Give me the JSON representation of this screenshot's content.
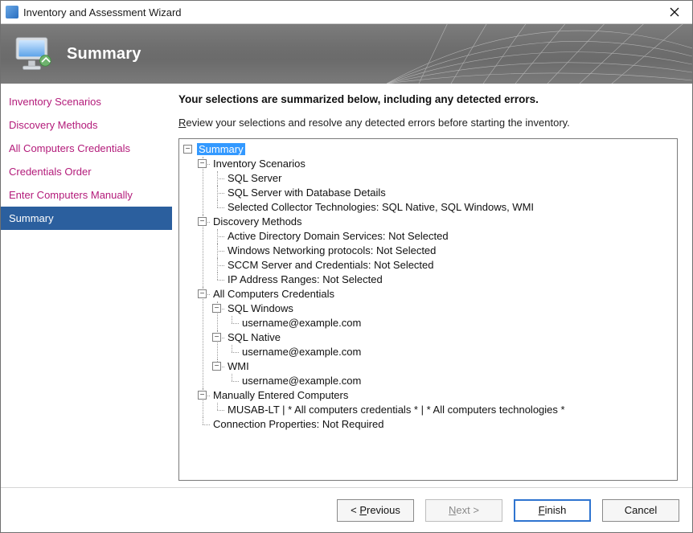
{
  "window": {
    "title": "Inventory and Assessment Wizard"
  },
  "banner": {
    "title": "Summary"
  },
  "sidebar": {
    "items": [
      {
        "label": "Inventory Scenarios",
        "state": "visited"
      },
      {
        "label": "Discovery Methods",
        "state": "visited"
      },
      {
        "label": "All Computers Credentials",
        "state": "visited"
      },
      {
        "label": "Credentials Order",
        "state": "visited"
      },
      {
        "label": "Enter Computers Manually",
        "state": "visited"
      },
      {
        "label": "Summary",
        "state": "active"
      }
    ]
  },
  "content": {
    "heading": "Your selections are summarized below, including any detected errors.",
    "subheading_prefix": "R",
    "subheading_rest": "eview your selections and resolve any detected errors before starting the inventory."
  },
  "tree": {
    "root": "Summary",
    "inventory_scenarios": {
      "label": "Inventory Scenarios",
      "items": [
        "SQL Server",
        "SQL Server with Database Details",
        "Selected Collector Technologies: SQL Native, SQL Windows, WMI"
      ]
    },
    "discovery_methods": {
      "label": "Discovery Methods",
      "items": [
        "Active Directory Domain Services: Not Selected",
        "Windows Networking protocols: Not Selected",
        "SCCM Server and Credentials: Not Selected",
        "IP Address Ranges: Not Selected"
      ]
    },
    "credentials": {
      "label": "All Computers Credentials",
      "groups": [
        {
          "name": "SQL Windows",
          "user": "username@example.com"
        },
        {
          "name": "SQL Native",
          "user": "username@example.com"
        },
        {
          "name": "WMI",
          "user": "username@example.com"
        }
      ]
    },
    "manual": {
      "label": "Manually Entered Computers",
      "items": [
        "MUSAB-LT | * All computers credentials * | * All computers technologies *"
      ]
    },
    "connection_properties": "Connection Properties: Not Required"
  },
  "footer": {
    "previous_prefix": "< ",
    "previous_ul": "P",
    "previous_rest": "revious",
    "next_ul": "N",
    "next_rest": "ext >",
    "finish_ul": "F",
    "finish_rest": "inish",
    "cancel": "Cancel"
  }
}
